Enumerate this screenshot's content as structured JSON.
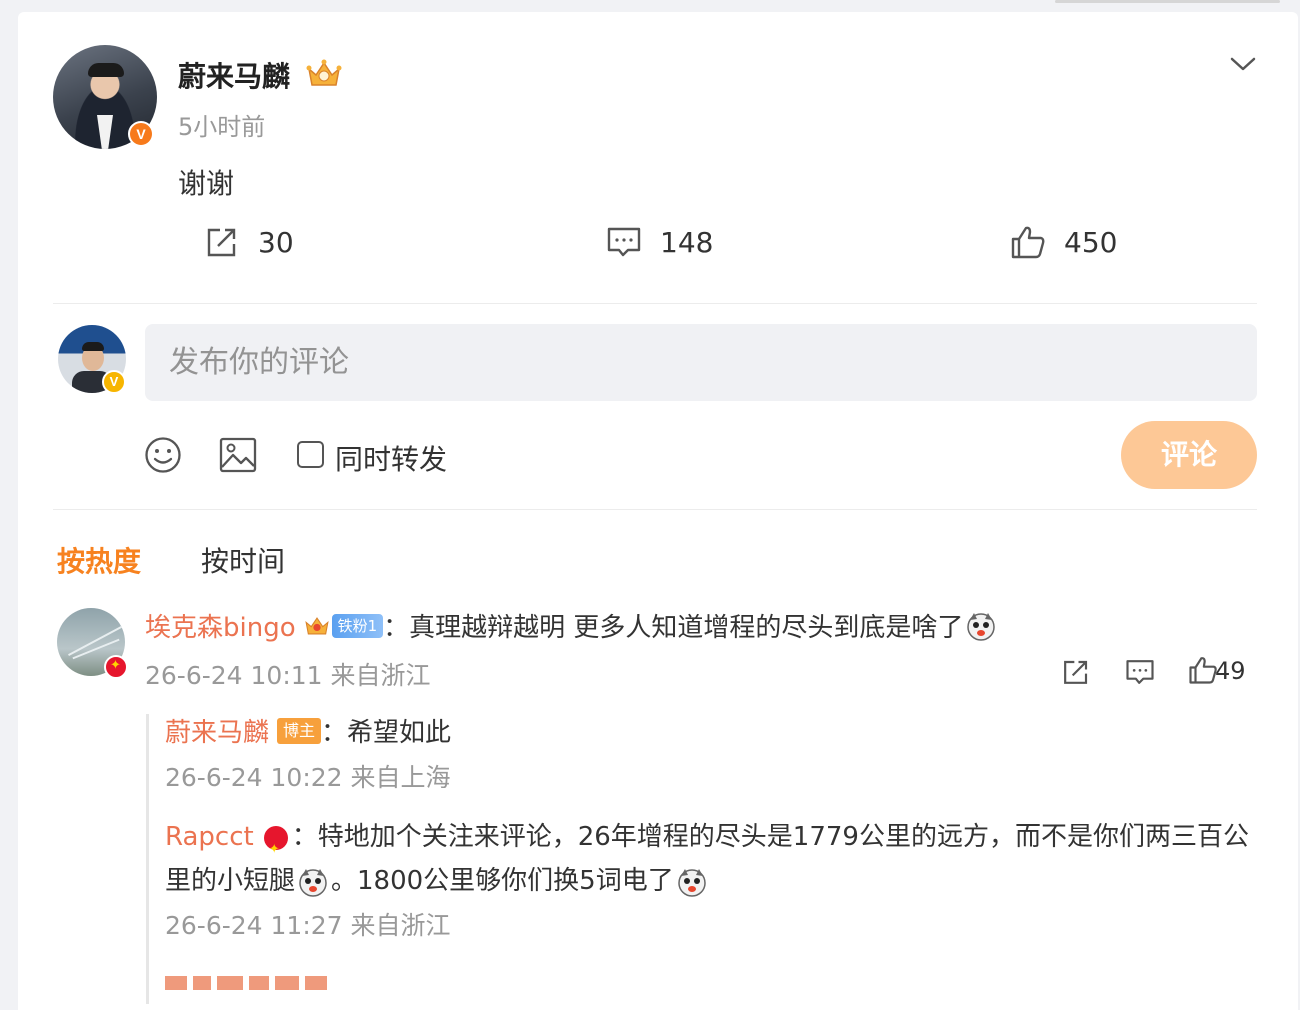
{
  "post": {
    "author": "蔚来马麟",
    "time": "5小时前",
    "text": "谢谢",
    "repost_count": "30",
    "comment_count": "148",
    "like_count": "450"
  },
  "composer": {
    "placeholder": "发布你的评论",
    "repost_option": "同时转发",
    "submit_label": "评论"
  },
  "sort": {
    "hot": "按热度",
    "time": "按时间"
  },
  "comments": [
    {
      "user": "埃克森bingo",
      "fan_badge": "铁粉1",
      "text": "：真理越辩越明 更多人知道增程的尽头到底是啥了",
      "meta": "26-6-24 10:11 来自浙江",
      "likes": "49",
      "replies": [
        {
          "user": "蔚来马麟",
          "badge": "博主",
          "text": "：希望如此",
          "meta": "26-6-24 10:22 来自上海"
        },
        {
          "user": "Rapcct",
          "text_a": "：特地加个关注来评论，26年增程的尽头是1779公里的远方，而不是你们两三百公里的小短腿",
          "text_b": "。1800公里够你们换5词电了",
          "meta": "26-6-24 11:27 来自浙江"
        }
      ]
    }
  ],
  "colors": {
    "accent": "#f7821f",
    "username": "#eb7350",
    "submit_disabled": "#fdc896",
    "verified": "#f77a1b"
  }
}
